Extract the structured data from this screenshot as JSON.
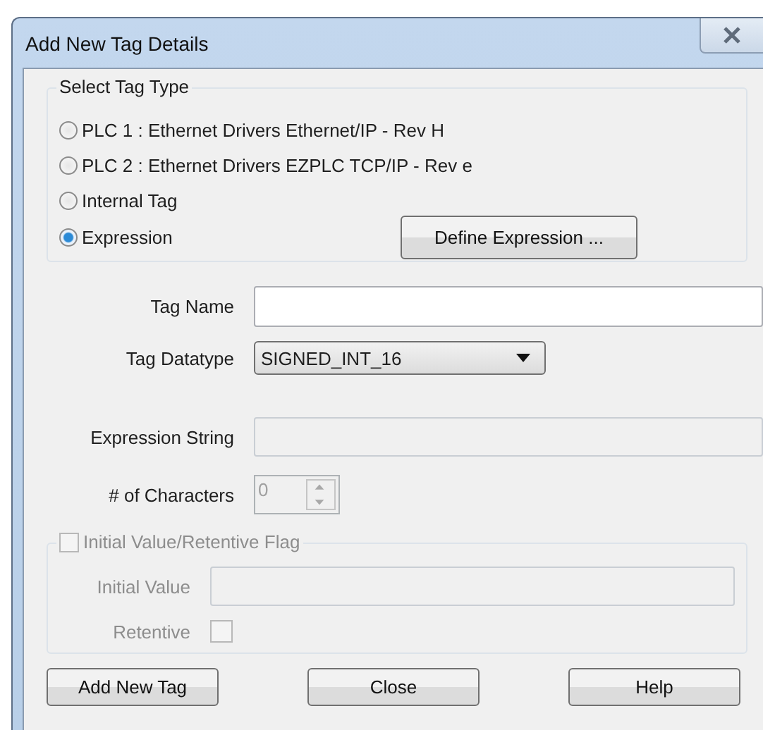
{
  "window": {
    "title": "Add New Tag Details"
  },
  "tag_type": {
    "legend": "Select Tag Type",
    "options": [
      {
        "label": "PLC 1 : Ethernet Drivers Ethernet/IP - Rev H",
        "selected": false
      },
      {
        "label": "PLC 2 : Ethernet Drivers EZPLC TCP/IP  - Rev e",
        "selected": false
      },
      {
        "label": "Internal Tag",
        "selected": false
      },
      {
        "label": "Expression",
        "selected": true
      }
    ],
    "define_button": "Define Expression ..."
  },
  "tag_name": {
    "label": "Tag Name"
  },
  "tag_datatype": {
    "label": "Tag Datatype",
    "value": "SIGNED_INT_16"
  },
  "expression_string": {
    "label": "Expression String",
    "disabled": true
  },
  "characters": {
    "label": "# of Characters",
    "value": "0",
    "disabled": true
  },
  "initial_group": {
    "label": "Initial Value/Retentive Flag",
    "checked": false,
    "disabled": true,
    "initial_value_label": "Initial Value",
    "retentive_label": "Retentive",
    "retentive_checked": false
  },
  "buttons": [
    "Add New Tag",
    "Close",
    "Help"
  ]
}
